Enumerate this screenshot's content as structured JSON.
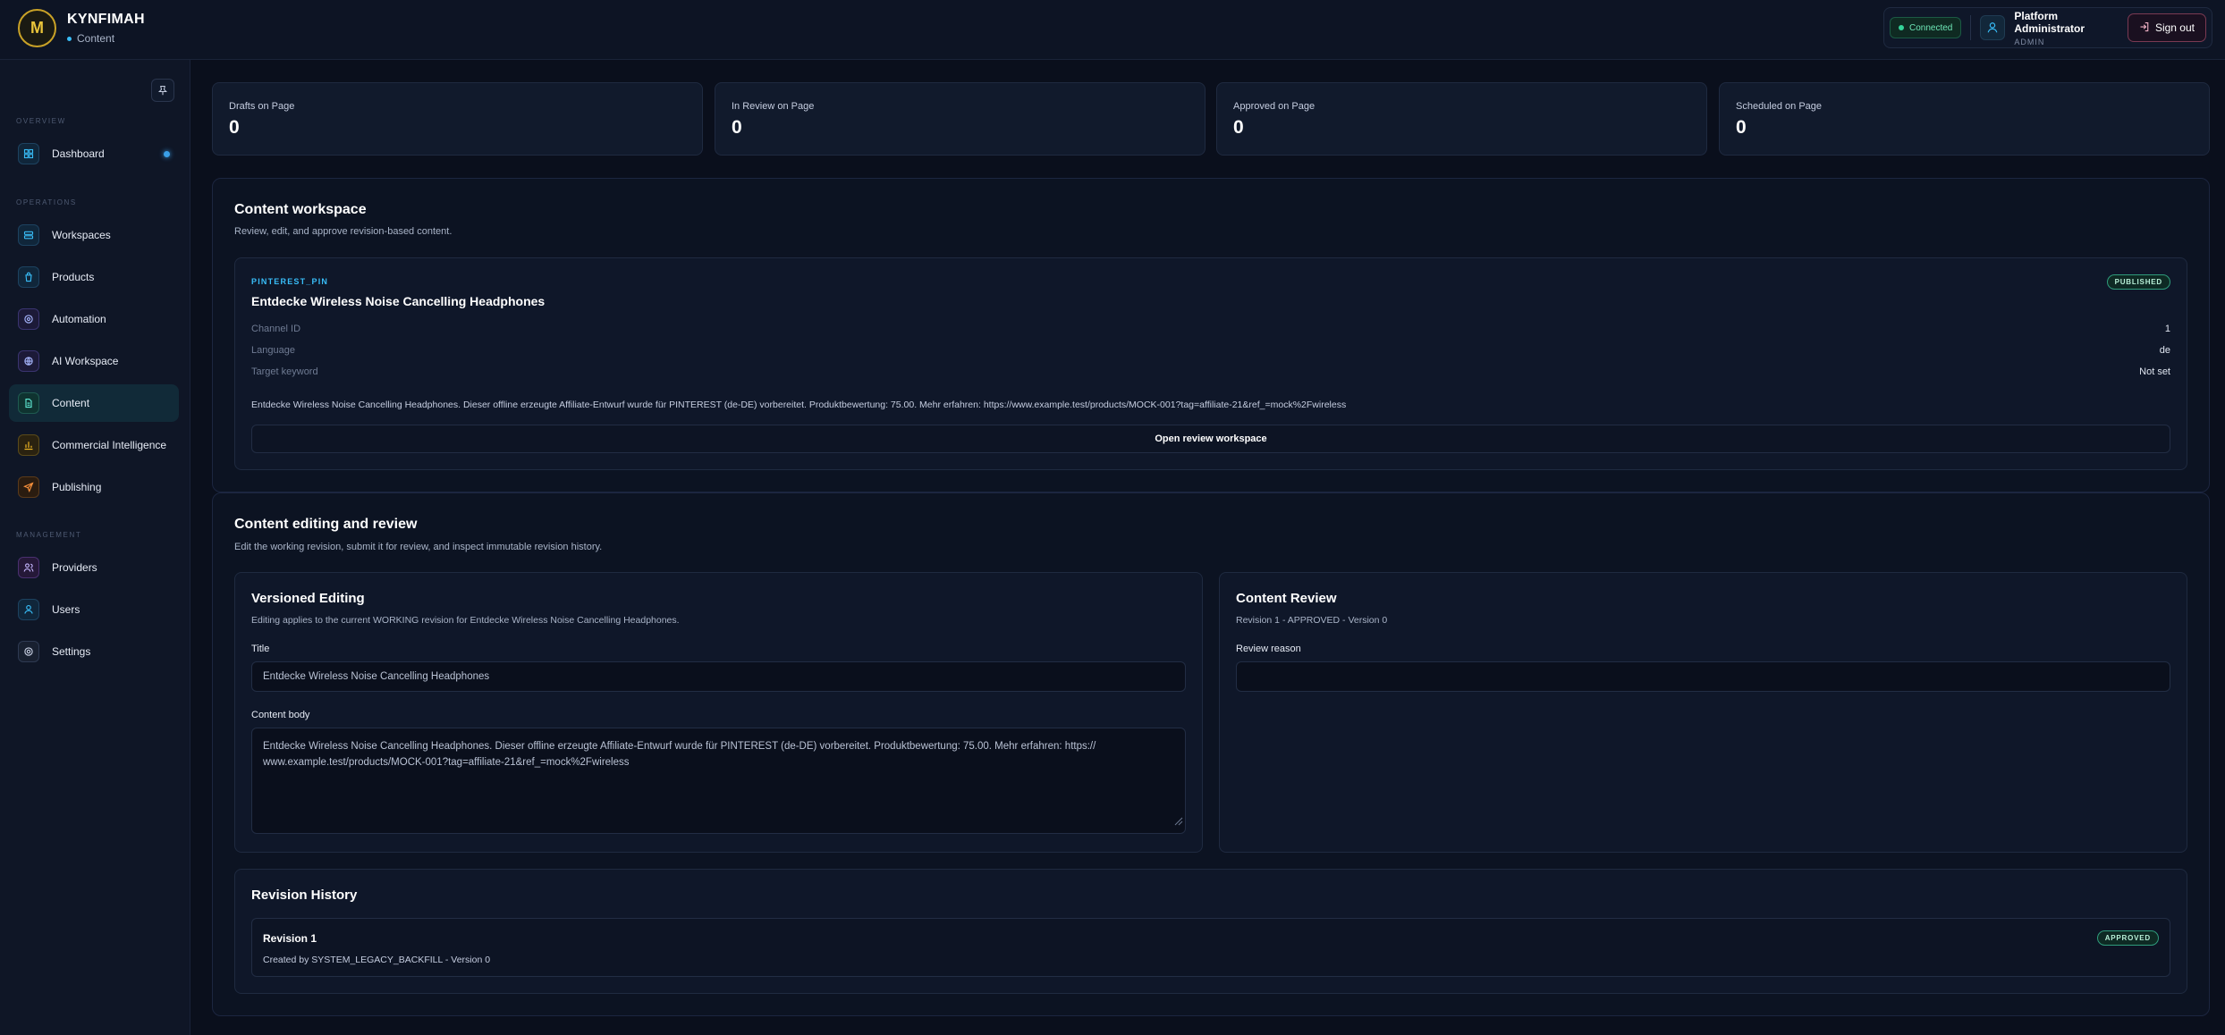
{
  "brand": {
    "initial": "M",
    "name": "KYNFIMAH",
    "section": "Content"
  },
  "header": {
    "connection_status": "Connected",
    "user_name": "Platform Administrator",
    "user_role": "ADMIN",
    "signout_label": "Sign out"
  },
  "sidebar": {
    "sections": {
      "overview": "OVERVIEW",
      "operations": "OPERATIONS",
      "management": "MANAGEMENT"
    },
    "items": [
      {
        "label": "Dashboard",
        "icon": "dashboard-icon"
      },
      {
        "label": "Workspaces",
        "icon": "workspaces-icon"
      },
      {
        "label": "Products",
        "icon": "products-icon"
      },
      {
        "label": "Automation",
        "icon": "automation-icon"
      },
      {
        "label": "AI Workspace",
        "icon": "ai-workspace-icon"
      },
      {
        "label": "Content",
        "icon": "content-icon",
        "active": true
      },
      {
        "label": "Commercial Intelligence",
        "icon": "commercial-intelligence-icon"
      },
      {
        "label": "Publishing",
        "icon": "publishing-icon"
      },
      {
        "label": "Providers",
        "icon": "providers-icon"
      },
      {
        "label": "Users",
        "icon": "users-icon"
      },
      {
        "label": "Settings",
        "icon": "settings-icon"
      }
    ]
  },
  "stats": [
    {
      "label": "Drafts on Page",
      "value": "0"
    },
    {
      "label": "In Review on Page",
      "value": "0"
    },
    {
      "label": "Approved on Page",
      "value": "0"
    },
    {
      "label": "Scheduled on Page",
      "value": "0"
    }
  ],
  "workspace": {
    "title": "Content workspace",
    "description": "Review, edit, and approve revision-based content.",
    "item": {
      "channel_type": "PINTEREST_PIN",
      "title": "Entdecke Wireless Noise Cancelling Headphones",
      "status": "PUBLISHED",
      "meta": [
        {
          "key": "Channel ID",
          "value": "1"
        },
        {
          "key": "Language",
          "value": "de"
        },
        {
          "key": "Target keyword",
          "value": "Not set"
        }
      ],
      "body": "Entdecke Wireless Noise Cancelling Headphones. Dieser offline erzeugte Affiliate-Entwurf wurde für PINTEREST (de-DE) vorbereitet. Produktbewertung: 75.00. Mehr erfahren: https://www.example.test/products/MOCK-001?tag=affiliate-21&ref_=mock%2Fwireless",
      "open_label": "Open review workspace"
    }
  },
  "editing": {
    "title": "Content editing and review",
    "description": "Edit the working revision, submit it for review, and inspect immutable revision history.",
    "versioned": {
      "title": "Versioned Editing",
      "description": "Editing applies to the current WORKING revision for Entdecke Wireless Noise Cancelling Headphones.",
      "title_label": "Title",
      "title_value": "Entdecke Wireless Noise Cancelling Headphones",
      "body_label": "Content body",
      "body_line1": "Entdecke Wireless Noise Cancelling Headphones. Dieser offline erzeugte Affiliate-Entwurf wurde für PINTEREST (de-DE) vorbereitet. Produktbewertung: 75.00. Mehr erfahren: https://",
      "body_line2": "www.example.test/products/MOCK-001?tag=affiliate-21&ref_=mock%2Fwireless"
    },
    "review": {
      "title": "Content Review",
      "subtitle": "Revision 1 - APPROVED - Version 0",
      "reason_label": "Review reason",
      "reason_value": ""
    },
    "history": {
      "title": "Revision History",
      "revisions": [
        {
          "title": "Revision 1",
          "meta": "Created by SYSTEM_LEGACY_BACKFILL - Version 0",
          "status": "APPROVED"
        }
      ]
    }
  }
}
